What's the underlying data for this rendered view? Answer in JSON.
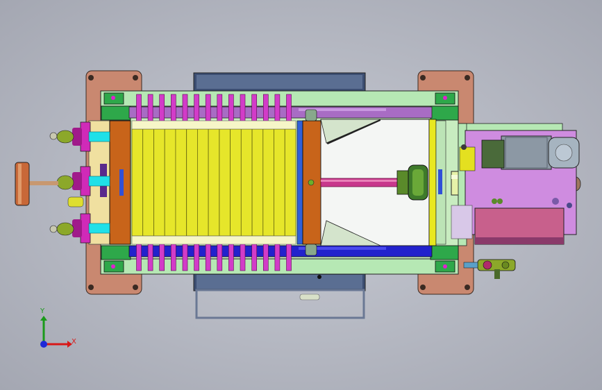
{
  "view": {
    "type": "CAD assembly model, top view",
    "background": "#b9bcc6"
  },
  "triad": {
    "x_label": "X",
    "y_label": "Y",
    "x_color": "#d81818",
    "y_color": "#1a9a1a",
    "z_color": "#1f2ad8"
  },
  "colors": {
    "base_plate": "#c98870",
    "frame_green": "#b6e8b4",
    "side_bar_purple": "#a86cc4",
    "side_bar_blue": "#2222cc",
    "filter_plate_yellow": "#e6e62a",
    "plate_handle_magenta": "#d23cc8",
    "head_plate_orange": "#c8641a",
    "cylinder_green": "#e6f2a8",
    "piston_rod": "#c8388c",
    "inlet_pipe_cyan": "#20e0e8",
    "flange_magenta": "#d02ab8",
    "valve_olive": "#8ca82a",
    "motor_grey": "#8c98a4",
    "hydraulic_tank_pink": "#c8608c",
    "drip_tray_blue": "#4a5e84",
    "feed_pipe_copper": "#c86838"
  },
  "plates": {
    "filter_plate_count": 15,
    "handle_count": 14
  }
}
